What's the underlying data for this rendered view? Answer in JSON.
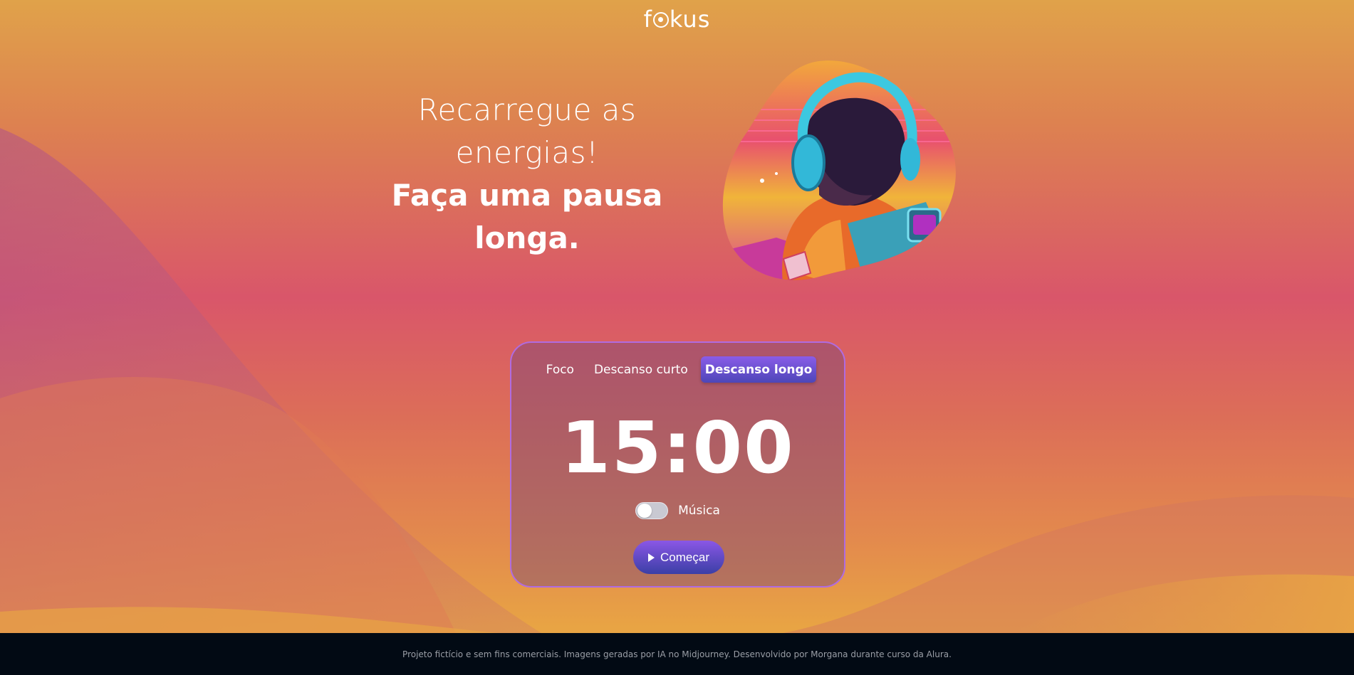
{
  "header": {
    "logo_left": "f",
    "logo_right": "kus"
  },
  "hero": {
    "title_light": "Recarregue as energias!",
    "title_bold": "Faça uma pausa longa."
  },
  "timer_card": {
    "tabs": [
      {
        "label": "Foco",
        "active": false
      },
      {
        "label": "Descanso curto",
        "active": false
      },
      {
        "label": "Descanso longo",
        "active": true
      }
    ],
    "time": "15:00",
    "music_label": "Música",
    "music_on": false,
    "start_label": "Começar"
  },
  "footer": {
    "text": "Projeto fictício e sem fins comerciais. Imagens geradas por IA no Midjourney. Desenvolvido por Morgana durante curso da Alura."
  },
  "colors": {
    "accent": "#6a4fd0",
    "footer_bg": "#020a14",
    "card_border": "#b06be0"
  }
}
